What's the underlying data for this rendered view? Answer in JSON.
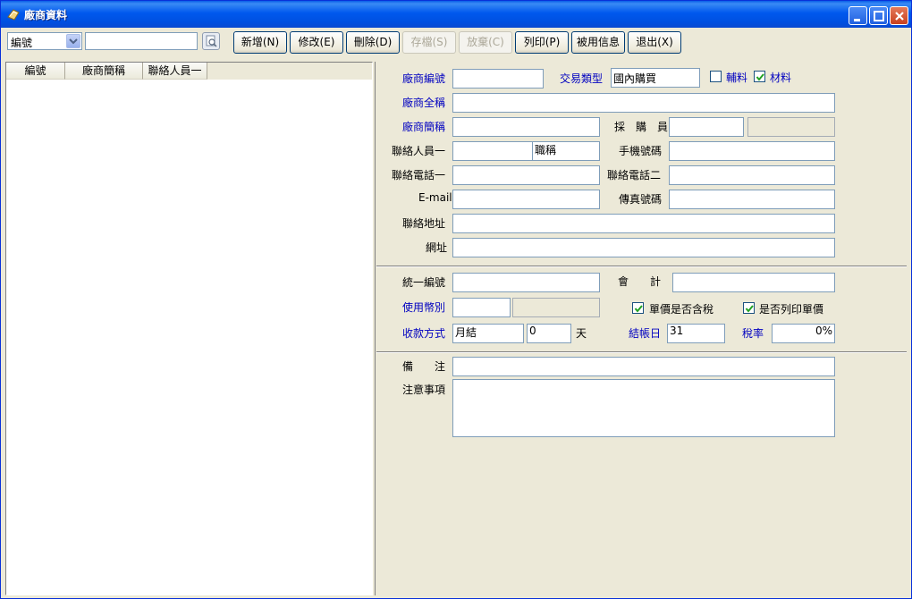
{
  "window": {
    "title": "廠商資料"
  },
  "search": {
    "field_selected": "編號",
    "value": ""
  },
  "toolbar": {
    "new": "新增(N)",
    "edit": "修改(E)",
    "delete": "刪除(D)",
    "save": "存檔(S)",
    "discard": "放棄(C)",
    "print": "列印(P)",
    "usage": "被用信息",
    "exit": "退出(X)"
  },
  "grid": {
    "columns": [
      "編號",
      "廠商簡稱",
      "聯絡人員一"
    ]
  },
  "form": {
    "vendor_no": {
      "label": "廠商編號",
      "value": ""
    },
    "trade_type": {
      "label": "交易類型",
      "value": "國內購買"
    },
    "aux_material": {
      "label": "輔料",
      "checked": false
    },
    "material": {
      "label": "材料",
      "checked": true
    },
    "full_name": {
      "label": "廠商全稱",
      "value": ""
    },
    "short_name": {
      "label": "廠商簡稱",
      "value": ""
    },
    "buyer": {
      "label": "採　購　員",
      "value": ""
    },
    "contact1": {
      "label": "聯絡人員一",
      "value": ""
    },
    "title_field": {
      "value": "職稱"
    },
    "mobile": {
      "label": "手機號碼",
      "value": ""
    },
    "phone1": {
      "label": "聯絡電話一",
      "value": ""
    },
    "phone2": {
      "label": "聯絡電話二",
      "value": ""
    },
    "email": {
      "label": "E-mail",
      "value": ""
    },
    "fax": {
      "label": "傳真號碼",
      "value": ""
    },
    "address": {
      "label": "聯絡地址",
      "value": ""
    },
    "website": {
      "label": "網址",
      "value": ""
    },
    "tax_id": {
      "label": "統一編號",
      "value": ""
    },
    "accountant": {
      "label": "會　　計",
      "value": ""
    },
    "currency": {
      "label": "使用幣別",
      "value": ""
    },
    "price_includes_tax": {
      "label": "單價是否含稅",
      "checked": true
    },
    "print_unit_price": {
      "label": "是否列印單價",
      "checked": true
    },
    "payment_method": {
      "label": "收款方式",
      "value": "月結"
    },
    "payment_days": {
      "value": "0",
      "unit": "天"
    },
    "closing_day": {
      "label": "結帳日",
      "value": "31"
    },
    "tax_rate": {
      "label": "稅率",
      "value": "0%"
    },
    "remark": {
      "label": "備　　注",
      "value": ""
    },
    "notes": {
      "label": "注意事項",
      "value": ""
    }
  },
  "colors": {
    "title_bar": "#0058ee",
    "label_blue": "#0000c0",
    "window_bg": "#ece9d8"
  }
}
